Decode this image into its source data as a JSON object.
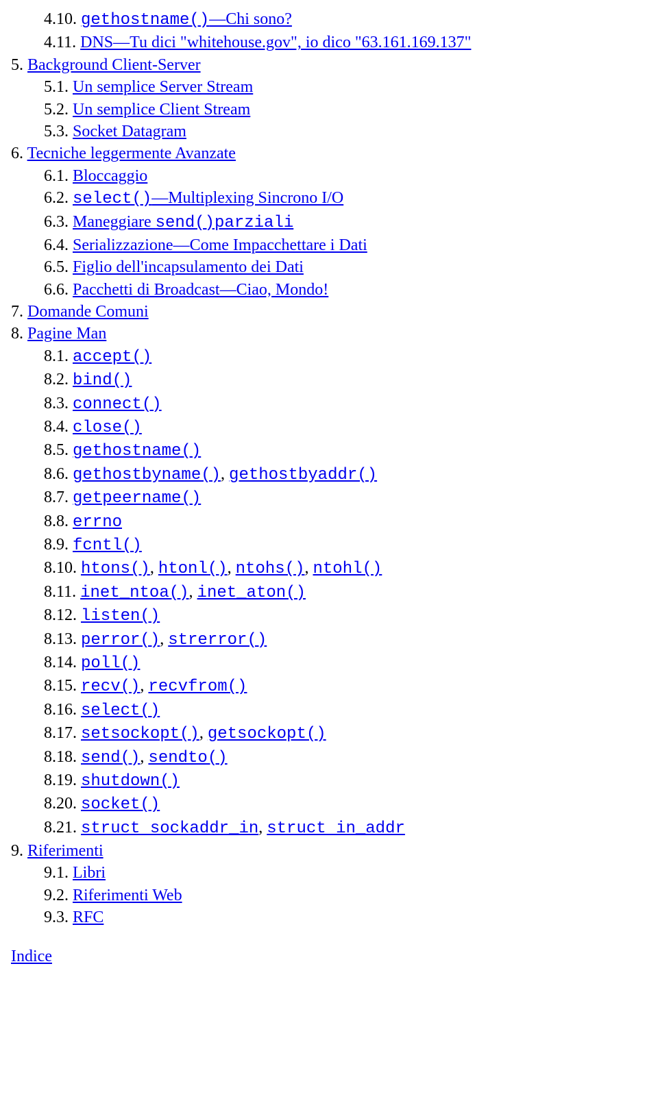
{
  "items": [
    {
      "level": 2,
      "num": "4.10.",
      "segments": [
        {
          "text": "gethostname()",
          "link": true,
          "mono": true
        },
        {
          "text": "—Chi sono?",
          "link": true,
          "mono": false
        }
      ]
    },
    {
      "level": 2,
      "num": "4.11.",
      "segments": [
        {
          "text": "DNS—Tu dici \"whitehouse.gov\", io dico \"63.161.169.137\"",
          "link": true,
          "mono": false
        }
      ]
    },
    {
      "level": 1,
      "num": "5.",
      "segments": [
        {
          "text": "Background Client-Server",
          "link": true,
          "mono": false
        }
      ]
    },
    {
      "level": 2,
      "num": "5.1.",
      "segments": [
        {
          "text": "Un semplice Server Stream",
          "link": true,
          "mono": false
        }
      ]
    },
    {
      "level": 2,
      "num": "5.2.",
      "segments": [
        {
          "text": "Un semplice Client Stream",
          "link": true,
          "mono": false
        }
      ]
    },
    {
      "level": 2,
      "num": "5.3.",
      "segments": [
        {
          "text": "Socket Datagram",
          "link": true,
          "mono": false
        }
      ]
    },
    {
      "level": 1,
      "num": "6.",
      "segments": [
        {
          "text": "Tecniche leggermente Avanzate",
          "link": true,
          "mono": false
        }
      ]
    },
    {
      "level": 2,
      "num": "6.1.",
      "segments": [
        {
          "text": "Bloccaggio",
          "link": true,
          "mono": false
        }
      ]
    },
    {
      "level": 2,
      "num": "6.2.",
      "segments": [
        {
          "text": "select()",
          "link": true,
          "mono": true
        },
        {
          "text": "—Multiplexing Sincrono I/O",
          "link": true,
          "mono": false
        }
      ]
    },
    {
      "level": 2,
      "num": "6.3.",
      "segments": [
        {
          "text": "Maneggiare ",
          "link": true,
          "mono": false
        },
        {
          "text": "send()",
          "link": true,
          "mono": true
        },
        {
          "text": "parziali",
          "link": true,
          "mono": true
        }
      ]
    },
    {
      "level": 2,
      "num": "6.4.",
      "segments": [
        {
          "text": "Serializzazione—Come Impacchettare i Dati",
          "link": true,
          "mono": false
        }
      ]
    },
    {
      "level": 2,
      "num": "6.5.",
      "segments": [
        {
          "text": "Figlio dell'incapsulamento dei Dati",
          "link": true,
          "mono": false
        }
      ]
    },
    {
      "level": 2,
      "num": "6.6.",
      "segments": [
        {
          "text": "Pacchetti di Broadcast—Ciao, Mondo!",
          "link": true,
          "mono": false
        }
      ]
    },
    {
      "level": 1,
      "num": "7.",
      "segments": [
        {
          "text": "Domande Comuni",
          "link": true,
          "mono": false
        }
      ]
    },
    {
      "level": 1,
      "num": "8.",
      "segments": [
        {
          "text": "Pagine Man",
          "link": true,
          "mono": false
        }
      ]
    },
    {
      "level": 2,
      "num": "8.1.",
      "segments": [
        {
          "text": "accept()",
          "link": true,
          "mono": true
        }
      ]
    },
    {
      "level": 2,
      "num": "8.2.",
      "segments": [
        {
          "text": "bind()",
          "link": true,
          "mono": true
        }
      ]
    },
    {
      "level": 2,
      "num": "8.3.",
      "segments": [
        {
          "text": "connect()",
          "link": true,
          "mono": true
        }
      ]
    },
    {
      "level": 2,
      "num": "8.4.",
      "segments": [
        {
          "text": "close()",
          "link": true,
          "mono": true
        }
      ]
    },
    {
      "level": 2,
      "num": "8.5.",
      "segments": [
        {
          "text": "gethostname()",
          "link": true,
          "mono": true
        }
      ]
    },
    {
      "level": 2,
      "num": "8.6.",
      "segments": [
        {
          "text": "gethostbyname()",
          "link": true,
          "mono": true
        },
        {
          "text": ", ",
          "link": false,
          "mono": false
        },
        {
          "text": "gethostbyaddr()",
          "link": true,
          "mono": true
        }
      ]
    },
    {
      "level": 2,
      "num": "8.7.",
      "segments": [
        {
          "text": "getpeername()",
          "link": true,
          "mono": true
        }
      ]
    },
    {
      "level": 2,
      "num": "8.8.",
      "segments": [
        {
          "text": "errno",
          "link": true,
          "mono": true
        }
      ]
    },
    {
      "level": 2,
      "num": "8.9.",
      "segments": [
        {
          "text": "fcntl()",
          "link": true,
          "mono": true
        }
      ]
    },
    {
      "level": 2,
      "num": "8.10.",
      "segments": [
        {
          "text": "htons()",
          "link": true,
          "mono": true
        },
        {
          "text": ", ",
          "link": false,
          "mono": false
        },
        {
          "text": "htonl()",
          "link": true,
          "mono": true
        },
        {
          "text": ", ",
          "link": false,
          "mono": false
        },
        {
          "text": "ntohs()",
          "link": true,
          "mono": true
        },
        {
          "text": ", ",
          "link": false,
          "mono": false
        },
        {
          "text": "ntohl()",
          "link": true,
          "mono": true
        }
      ]
    },
    {
      "level": 2,
      "num": "8.11.",
      "segments": [
        {
          "text": "inet_ntoa()",
          "link": true,
          "mono": true
        },
        {
          "text": ", ",
          "link": false,
          "mono": false
        },
        {
          "text": "inet_aton()",
          "link": true,
          "mono": true
        }
      ]
    },
    {
      "level": 2,
      "num": "8.12.",
      "segments": [
        {
          "text": "listen()",
          "link": true,
          "mono": true
        }
      ]
    },
    {
      "level": 2,
      "num": "8.13.",
      "segments": [
        {
          "text": "perror()",
          "link": true,
          "mono": true
        },
        {
          "text": ", ",
          "link": false,
          "mono": false
        },
        {
          "text": "strerror()",
          "link": true,
          "mono": true
        }
      ]
    },
    {
      "level": 2,
      "num": "8.14.",
      "segments": [
        {
          "text": "poll()",
          "link": true,
          "mono": true
        }
      ]
    },
    {
      "level": 2,
      "num": "8.15.",
      "segments": [
        {
          "text": "recv()",
          "link": true,
          "mono": true
        },
        {
          "text": ", ",
          "link": false,
          "mono": false
        },
        {
          "text": "recvfrom()",
          "link": true,
          "mono": true
        }
      ]
    },
    {
      "level": 2,
      "num": "8.16.",
      "segments": [
        {
          "text": "select()",
          "link": true,
          "mono": true
        }
      ]
    },
    {
      "level": 2,
      "num": "8.17.",
      "segments": [
        {
          "text": "setsockopt()",
          "link": true,
          "mono": true
        },
        {
          "text": ", ",
          "link": false,
          "mono": false
        },
        {
          "text": "getsockopt()",
          "link": true,
          "mono": true
        }
      ]
    },
    {
      "level": 2,
      "num": "8.18.",
      "segments": [
        {
          "text": "send()",
          "link": true,
          "mono": true
        },
        {
          "text": ", ",
          "link": false,
          "mono": false
        },
        {
          "text": "sendto()",
          "link": true,
          "mono": true
        }
      ]
    },
    {
      "level": 2,
      "num": "8.19.",
      "segments": [
        {
          "text": "shutdown()",
          "link": true,
          "mono": true
        }
      ]
    },
    {
      "level": 2,
      "num": "8.20.",
      "segments": [
        {
          "text": "socket()",
          "link": true,
          "mono": true
        }
      ]
    },
    {
      "level": 2,
      "num": "8.21.",
      "segments": [
        {
          "text": "struct sockaddr_in",
          "link": true,
          "mono": true
        },
        {
          "text": ", ",
          "link": false,
          "mono": false
        },
        {
          "text": "struct in_addr",
          "link": true,
          "mono": true
        }
      ]
    },
    {
      "level": 1,
      "num": "9.",
      "segments": [
        {
          "text": "Riferimenti",
          "link": true,
          "mono": false
        }
      ]
    },
    {
      "level": 2,
      "num": "9.1.",
      "segments": [
        {
          "text": "Libri",
          "link": true,
          "mono": false
        }
      ]
    },
    {
      "level": 2,
      "num": "9.2.",
      "segments": [
        {
          "text": "Riferimenti Web",
          "link": true,
          "mono": false
        }
      ]
    },
    {
      "level": 2,
      "num": "9.3.",
      "segments": [
        {
          "text": "RFC",
          "link": true,
          "mono": false
        }
      ]
    }
  ],
  "index_label": "Indice"
}
